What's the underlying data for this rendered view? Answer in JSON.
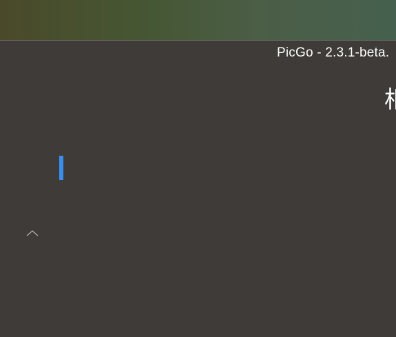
{
  "window": {
    "title": "PicGo - 2.3.1-beta."
  },
  "main": {
    "heading": "相"
  },
  "sidebar": {
    "active_indicator_color": "#3a8ef0",
    "collapse_icon": "chevron-up-icon"
  },
  "colors": {
    "background": "#3e3b38",
    "accent": "#3a8ef0"
  }
}
